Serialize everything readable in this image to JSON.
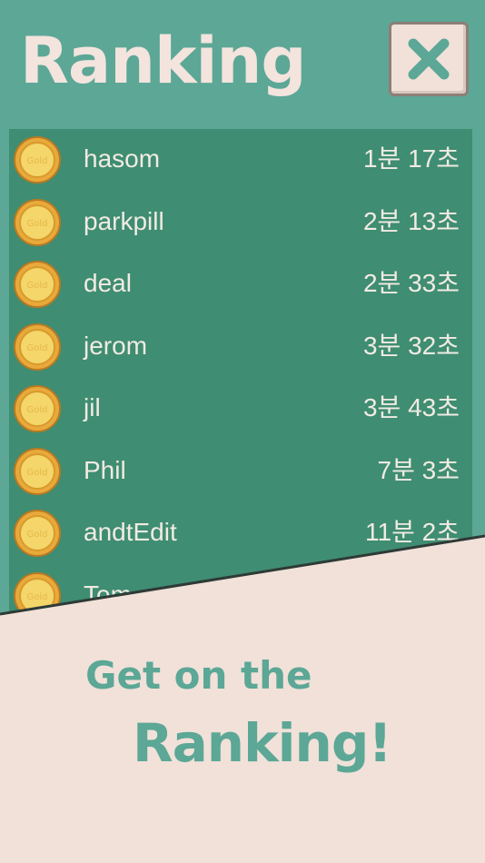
{
  "header": {
    "title": "Ranking",
    "close_icon": "close-x-icon"
  },
  "ranking": {
    "coin_label": "Gold",
    "rows": [
      {
        "name": "hasom",
        "time": "1분 17초"
      },
      {
        "name": "parkpill",
        "time": "2분 13초"
      },
      {
        "name": "deal",
        "time": "2분 33초"
      },
      {
        "name": "jerom",
        "time": "3분 32초"
      },
      {
        "name": "jil",
        "time": "3분 43초"
      },
      {
        "name": "Phil",
        "time": "7분 3초"
      },
      {
        "name": "andtEdit",
        "time": "11분 2초"
      },
      {
        "name": "Tom",
        "time": ""
      }
    ]
  },
  "promo": {
    "line1": "Get on the",
    "line2": "Ranking!"
  },
  "colors": {
    "background": "#5ca796",
    "panel": "#3f8d72",
    "cream": "#f1e1d9",
    "text_light": "#f1ebe4"
  }
}
